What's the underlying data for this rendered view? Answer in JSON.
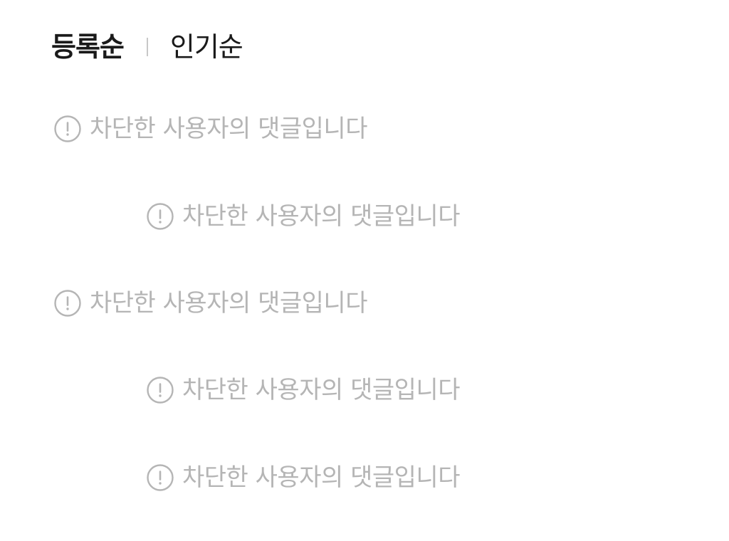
{
  "sort": {
    "options": [
      {
        "label": "등록순",
        "active": true
      },
      {
        "label": "인기순",
        "active": false
      }
    ]
  },
  "comments": [
    {
      "depth": 0,
      "text": "차단한 사용자의 댓글입니다",
      "icon": "alert-circle-icon"
    },
    {
      "depth": 1,
      "text": "차단한 사용자의 댓글입니다",
      "icon": "alert-circle-icon"
    },
    {
      "depth": 0,
      "text": "차단한 사용자의 댓글입니다",
      "icon": "alert-circle-icon"
    },
    {
      "depth": 1,
      "text": "차단한 사용자의 댓글입니다",
      "icon": "alert-circle-icon"
    },
    {
      "depth": 1,
      "text": "차단한 사용자의 댓글입니다",
      "icon": "alert-circle-icon"
    }
  ],
  "colors": {
    "active_text": "#1a1a1a",
    "muted_text": "#b5b5b5",
    "icon_stroke": "#b5b5b5",
    "divider": "#c8c8c8"
  }
}
